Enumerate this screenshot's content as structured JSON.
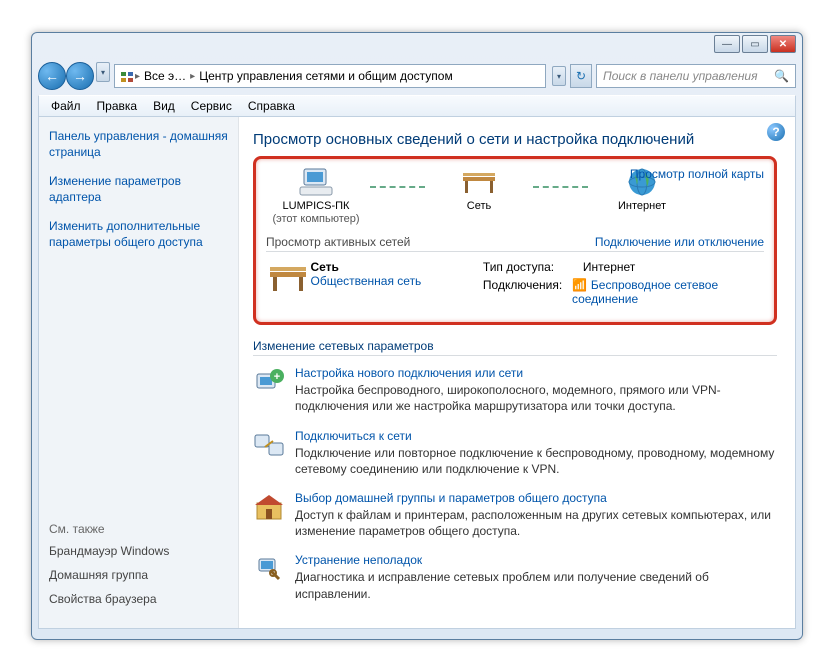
{
  "breadcrumb": {
    "root": "Все э…",
    "page": "Центр управления сетями и общим доступом"
  },
  "search": {
    "placeholder": "Поиск в панели управления"
  },
  "menu": {
    "file": "Файл",
    "edit": "Правка",
    "view": "Вид",
    "service": "Сервис",
    "help": "Справка"
  },
  "sidebar": {
    "home": "Панель управления - домашняя страница",
    "links": [
      "Изменение параметров адаптера",
      "Изменить дополнительные параметры общего доступа"
    ],
    "seealso": "См. также",
    "grey": [
      "Брандмауэр Windows",
      "Домашняя группа",
      "Свойства браузера"
    ]
  },
  "heading": "Просмотр основных сведений о сети и настройка подключений",
  "map": {
    "fullmap": "Просмотр полной карты",
    "pc": "LUMPICS-ПК",
    "pcsub": "(этот компьютер)",
    "net": "Сеть",
    "inet": "Интернет"
  },
  "active": {
    "title": "Просмотр активных сетей",
    "connlink": "Подключение или отключение",
    "name": "Сеть",
    "type": "Общественная сеть",
    "access_k": "Тип доступа:",
    "access_v": "Интернет",
    "conn_k": "Подключения:",
    "conn_v": "Беспроводное сетевое соединение"
  },
  "changes": {
    "title": "Изменение сетевых параметров",
    "tasks": [
      {
        "title": "Настройка нового подключения или сети",
        "desc": "Настройка беспроводного, широкополосного, модемного, прямого или VPN-подключения или же настройка маршрутизатора или точки доступа."
      },
      {
        "title": "Подключиться к сети",
        "desc": "Подключение или повторное подключение к беспроводному, проводному, модемному сетевому соединению или подключение к VPN."
      },
      {
        "title": "Выбор домашней группы и параметров общего доступа",
        "desc": "Доступ к файлам и принтерам, расположенным на других сетевых компьютерах, или изменение параметров общего доступа."
      },
      {
        "title": "Устранение неполадок",
        "desc": "Диагностика и исправление сетевых проблем или получение сведений об исправлении."
      }
    ]
  }
}
